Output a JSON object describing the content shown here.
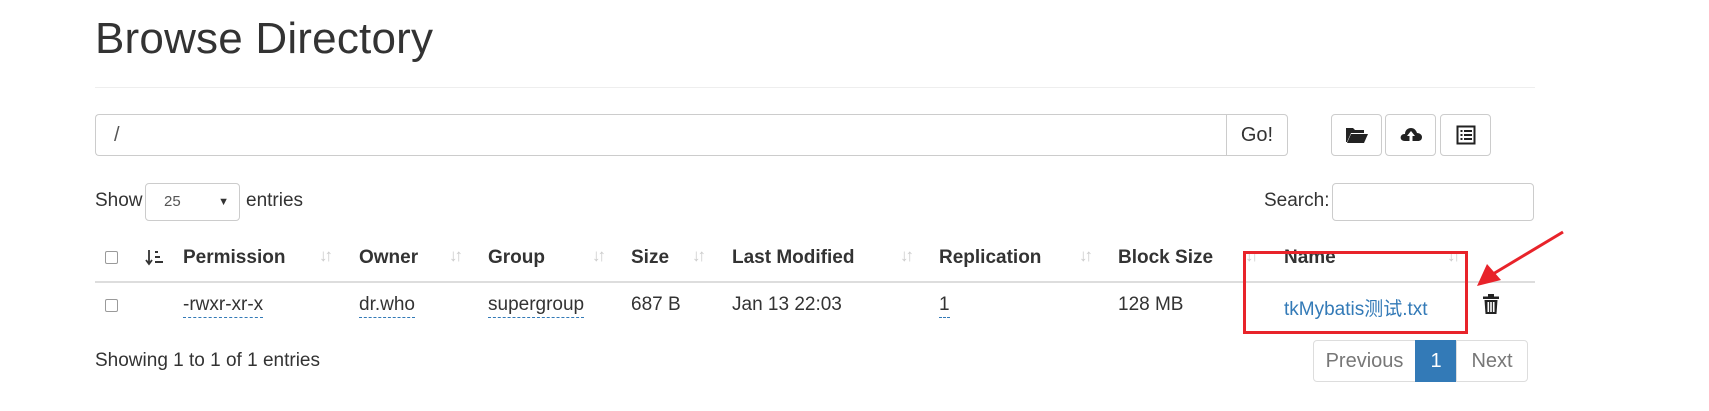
{
  "header": {
    "title": "Browse Directory"
  },
  "path_bar": {
    "value": "/",
    "go_label": "Go!"
  },
  "toolbar": {
    "icons": [
      "folder-open-icon",
      "cloud-upload-icon",
      "list-alt-icon"
    ]
  },
  "length_control": {
    "show_label": "Show",
    "selected": "25",
    "entries_label": "entries"
  },
  "search": {
    "label": "Search:",
    "value": ""
  },
  "table": {
    "columns": [
      "Permission",
      "Owner",
      "Group",
      "Size",
      "Last Modified",
      "Replication",
      "Block Size",
      "Name"
    ],
    "rows": [
      {
        "permission": "-rwxr-xr-x",
        "owner": "dr.who",
        "group": "supergroup",
        "size": "687 B",
        "last_modified": "Jan 13 22:03",
        "replication": "1",
        "block_size": "128 MB",
        "name": "tkMybatis测试.txt"
      }
    ]
  },
  "footer": {
    "info": "Showing 1 to 1 of 1 entries"
  },
  "pagination": {
    "previous": "Previous",
    "current": "1",
    "next": "Next"
  },
  "colors": {
    "link": "#337ab7",
    "annotation": "#e8232a",
    "border": "#cccccc"
  }
}
